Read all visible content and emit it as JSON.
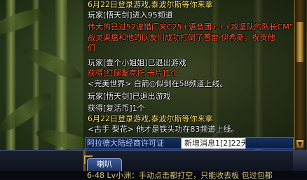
{
  "chat": {
    "lines": [
      {
        "text": "6月22日登录游戏,泰波尔斯等你来拿",
        "color": "#ffe36a"
      },
      {
        "text": "玩家[悟天剑]进入95频道",
        "color": "#f0f0f0"
      },
      {
        "text": "伟大的已过52波猎门来C25+语音团+++攻坚队的队长CM”",
        "color": "#ff5a3c"
      },
      {
        "text": "战灵渠瘟和他的队友们成功打倒了普雷·伊希斯。祝贺他",
        "color": "#ff5a3c"
      },
      {
        "text": "们",
        "color": "#ff5a3c"
      },
      {
        "text": "玩家[壹个小姐姐]已退出游戏",
        "color": "#f0f0f0"
      },
      {
        "text": "获得[红腿髦克托 卡片]1个",
        "color": "#ff5a3c"
      },
      {
        "text": "<完美世界> 白箭◎似剑在58频道上线。",
        "color": "#f0f0f0"
      },
      {
        "text": "玩家[悟天剑]已退出游戏",
        "color": "#f0f0f0"
      },
      {
        "text": "获得[复活币]1个",
        "color": "#f0f0f0"
      },
      {
        "text": "6月22日登录游戏,泰波尔斯等你来拿",
        "color": "#ffe36a"
      },
      {
        "text": "<古手 梨花> 他才是铁头功在83频道上线。",
        "color": "#f0f0f0"
      }
    ],
    "notice": "阿拉德大陆经商许可证",
    "tooltip": "新增消息1[2]22天。"
  },
  "tabs": {
    "shout_label": "喇叭"
  },
  "bottom": {
    "text": "6-48 Lv小洲：手动点击都打空，只能收去板 包过包都"
  },
  "scroll": {
    "down_icon": "▼"
  }
}
